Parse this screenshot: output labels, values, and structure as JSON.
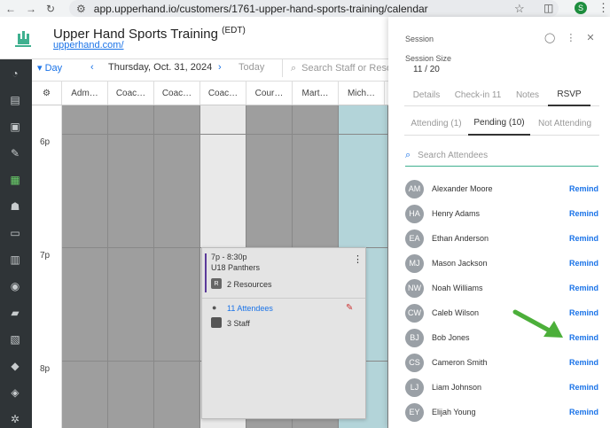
{
  "browser": {
    "url": "app.upperhand.io/customers/1761-upper-hand-sports-training/calendar",
    "profile_initial": "S"
  },
  "app": {
    "title": "Upper Hand Sports Training",
    "timezone": "(EDT)",
    "site_link": "upperhand.com/"
  },
  "toolbar": {
    "view": "Day",
    "date": "Thursday, Oct. 31, 2024",
    "today": "Today",
    "search_placeholder": "Search Staff or Resou"
  },
  "columns": [
    "Adm…",
    "Coac…",
    "Coac…",
    "Coac…",
    "Cour…",
    "Mart…",
    "Mich…"
  ],
  "time_labels": [
    "6p",
    "7p",
    "8p"
  ],
  "event": {
    "time": "7p - 8:30p",
    "name": "U18 Panthers",
    "resource_badge": "R",
    "resources": "2 Resources",
    "attendees": "11 Attendees",
    "staff": "3 Staff"
  },
  "panel": {
    "label": "Session",
    "session_size_label": "Session Size",
    "session_size": "11 / 20",
    "tabs": [
      "Details",
      "Check-in 11",
      "Notes",
      "RSVP"
    ],
    "active_tab": "RSVP",
    "subtabs": [
      "Attending (1)",
      "Pending (10)",
      "Not Attending"
    ],
    "active_subtab": "Pending (10)",
    "search_placeholder": "Search Attendees",
    "remind_label": "Remind",
    "attendees": [
      {
        "initials": "AM",
        "name": "Alexander Moore"
      },
      {
        "initials": "HA",
        "name": "Henry Adams"
      },
      {
        "initials": "EA",
        "name": "Ethan Anderson"
      },
      {
        "initials": "MJ",
        "name": "Mason Jackson"
      },
      {
        "initials": "NW",
        "name": "Noah Williams"
      },
      {
        "initials": "CW",
        "name": "Caleb Wilson"
      },
      {
        "initials": "BJ",
        "name": "Bob Jones"
      },
      {
        "initials": "CS",
        "name": "Cameron Smith"
      },
      {
        "initials": "LJ",
        "name": "Liam Johnson"
      },
      {
        "initials": "EY",
        "name": "Elijah Young"
      }
    ]
  },
  "colors": {
    "accent": "#1a73e8",
    "sidebar": "#2f3437",
    "arrow": "#4caf3a",
    "brand_green": "#3fb08f"
  },
  "icons": [
    "back-icon",
    "forward-icon",
    "reload-icon",
    "tune-icon",
    "star-icon",
    "extensions-icon",
    "menu-icon",
    "chat-icon",
    "more-icon",
    "close-icon",
    "search-icon",
    "gear-icon"
  ]
}
